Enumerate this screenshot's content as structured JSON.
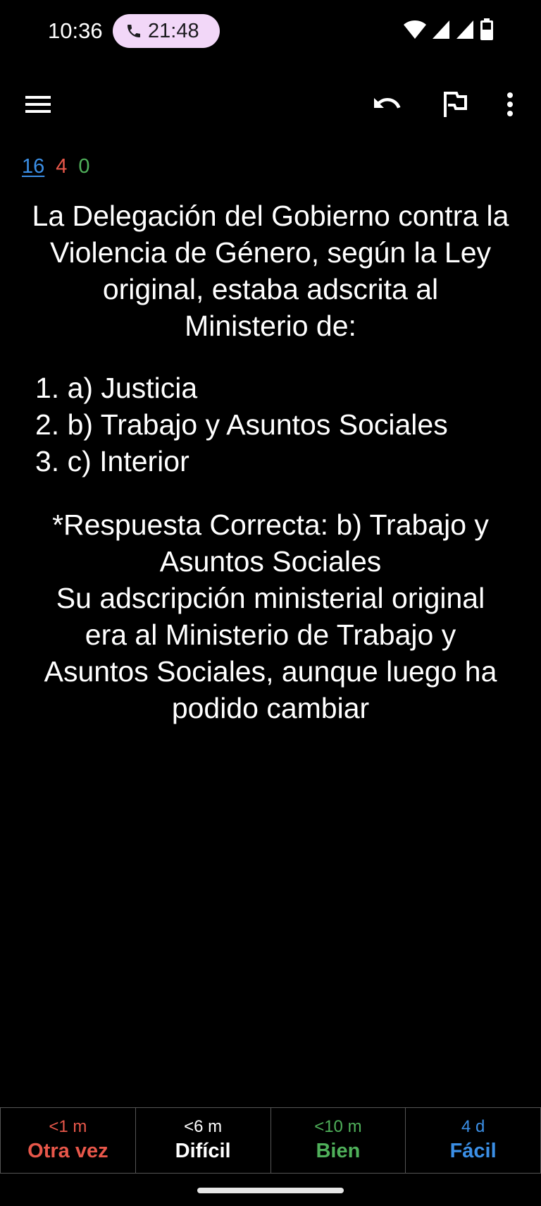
{
  "status_bar": {
    "time": "10:36",
    "call_duration": "21:48",
    "icons": [
      "phone-icon",
      "wifi-icon",
      "signal-icon",
      "signal-icon",
      "battery-icon"
    ]
  },
  "toolbar": {
    "icons": [
      "menu-icon",
      "undo-icon",
      "flag-icon",
      "more-vert-icon"
    ]
  },
  "counts": {
    "new": "16",
    "learning": "4",
    "review": "0"
  },
  "card": {
    "question_lines": [
      "La Delegación del Gobierno contra la",
      "Violencia de Género, según la Ley",
      "original, estaba adscrita al",
      "Ministerio de:"
    ],
    "options": [
      "1. a) Justicia",
      "2. b) Trabajo y Asuntos Sociales",
      "3. c) Interior"
    ],
    "answer_lines": [
      "*Respuesta Correcta: b) Trabajo y",
      "Asuntos Sociales",
      "Su adscripción ministerial original",
      "era al Ministerio de Trabajo y",
      "Asuntos Sociales, aunque luego ha",
      "podido cambiar"
    ]
  },
  "ease_buttons": [
    {
      "interval": "<1 m",
      "label": "Otra vez",
      "color": "#e8574a"
    },
    {
      "interval": "<6 m",
      "label": "Difícil",
      "color": "#ffffff"
    },
    {
      "interval": "<10 m",
      "label": "Bien",
      "color": "#4fb05a"
    },
    {
      "interval": "4 d",
      "label": "Fácil",
      "color": "#3b8fe6"
    }
  ],
  "colors": {
    "background": "#000000",
    "new_count": "#3b8fe6",
    "learning_count": "#e8574a",
    "review_count": "#4fb05a",
    "call_pill": "#f2d7f8"
  }
}
